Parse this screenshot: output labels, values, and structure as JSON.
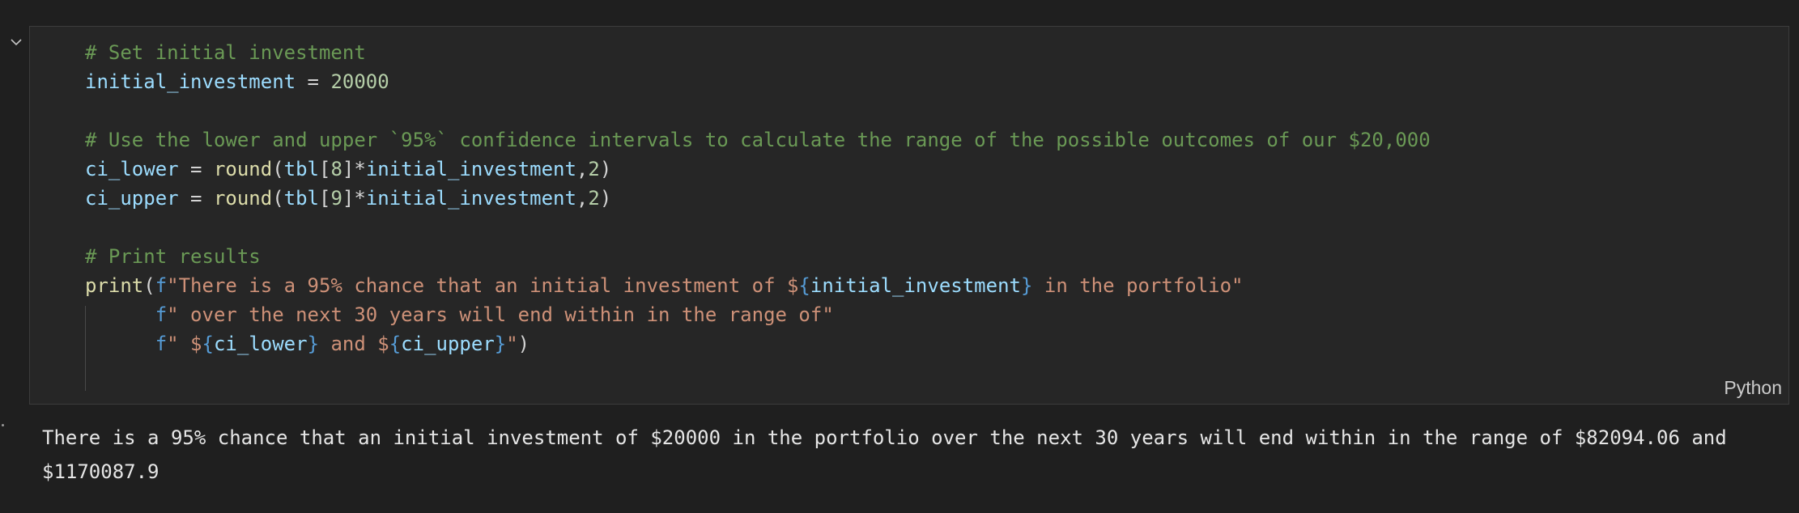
{
  "cell": {
    "language_label": "Python",
    "code_lines": [
      [
        {
          "t": "# Set initial investment",
          "c": "comment"
        }
      ],
      [
        {
          "t": "initial_investment",
          "c": "var"
        },
        {
          "t": " = ",
          "c": "punc"
        },
        {
          "t": "20000",
          "c": "num"
        }
      ],
      [],
      [
        {
          "t": "# Use the lower and upper `95%` confidence intervals to calculate the range of the possible outcomes of our $20,000",
          "c": "comment"
        }
      ],
      [
        {
          "t": "ci_lower",
          "c": "var"
        },
        {
          "t": " = ",
          "c": "punc"
        },
        {
          "t": "round",
          "c": "func"
        },
        {
          "t": "(",
          "c": "punc"
        },
        {
          "t": "tbl",
          "c": "var"
        },
        {
          "t": "[",
          "c": "punc"
        },
        {
          "t": "8",
          "c": "num"
        },
        {
          "t": "]*",
          "c": "punc"
        },
        {
          "t": "initial_investment",
          "c": "var"
        },
        {
          "t": ",",
          "c": "punc"
        },
        {
          "t": "2",
          "c": "num"
        },
        {
          "t": ")",
          "c": "punc"
        }
      ],
      [
        {
          "t": "ci_upper",
          "c": "var"
        },
        {
          "t": " = ",
          "c": "punc"
        },
        {
          "t": "round",
          "c": "func"
        },
        {
          "t": "(",
          "c": "punc"
        },
        {
          "t": "tbl",
          "c": "var"
        },
        {
          "t": "[",
          "c": "punc"
        },
        {
          "t": "9",
          "c": "num"
        },
        {
          "t": "]*",
          "c": "punc"
        },
        {
          "t": "initial_investment",
          "c": "var"
        },
        {
          "t": ",",
          "c": "punc"
        },
        {
          "t": "2",
          "c": "num"
        },
        {
          "t": ")",
          "c": "punc"
        }
      ],
      [],
      [
        {
          "t": "# Print results",
          "c": "comment"
        }
      ],
      [
        {
          "t": "print",
          "c": "func"
        },
        {
          "t": "(",
          "c": "punc"
        },
        {
          "t": "f",
          "c": "kw"
        },
        {
          "t": "\"There is a 95% chance that an initial investment of $",
          "c": "str"
        },
        {
          "t": "{",
          "c": "brace"
        },
        {
          "t": "initial_investment",
          "c": "var"
        },
        {
          "t": "}",
          "c": "brace"
        },
        {
          "t": " in the portfolio\"",
          "c": "str"
        }
      ],
      [
        {
          "t": "      ",
          "c": "punc"
        },
        {
          "t": "f",
          "c": "kw"
        },
        {
          "t": "\" over the next 30 years will end within in the range of\"",
          "c": "str"
        }
      ],
      [
        {
          "t": "      ",
          "c": "punc"
        },
        {
          "t": "f",
          "c": "kw"
        },
        {
          "t": "\" $",
          "c": "str"
        },
        {
          "t": "{",
          "c": "brace"
        },
        {
          "t": "ci_lower",
          "c": "var"
        },
        {
          "t": "}",
          "c": "brace"
        },
        {
          "t": " and $",
          "c": "str"
        },
        {
          "t": "{",
          "c": "brace"
        },
        {
          "t": "ci_upper",
          "c": "var"
        },
        {
          "t": "}",
          "c": "brace"
        },
        {
          "t": "\"",
          "c": "str"
        },
        {
          "t": ")",
          "c": "punc"
        }
      ]
    ]
  },
  "output": {
    "text": "There is a 95% chance that an initial investment of $20000 in the portfolio over the next 30 years will end within in the range of $82094.06 and $1170087.9"
  }
}
